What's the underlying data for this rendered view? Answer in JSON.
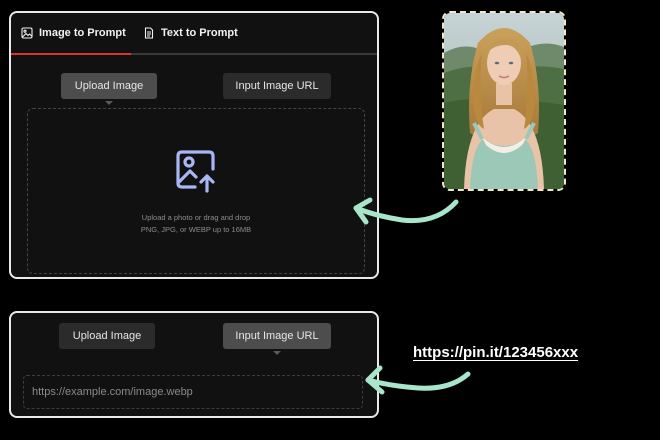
{
  "tabs": [
    {
      "label": "Image to Prompt",
      "icon": "image-icon",
      "active": true
    },
    {
      "label": "Text to Prompt",
      "icon": "document-icon",
      "active": false
    }
  ],
  "top_panel": {
    "upload_button": "Upload Image",
    "url_button": "Input Image URL",
    "dropzone": {
      "icon": "image-upload-icon",
      "line1": "Upload a photo or drag and drop",
      "line2": "PNG, JPG, or WEBP up to 16MB"
    }
  },
  "bottom_panel": {
    "upload_button": "Upload Image",
    "url_button": "Input Image URL",
    "url_placeholder": "https://example.com/image.webp"
  },
  "annotation": {
    "url_example": "https://pin.it/123456xxx"
  },
  "colors": {
    "accent": "#e0312f",
    "arrow": "#a8e6cc",
    "panel_border": "#e9e9e9",
    "upload_icon": "#a9b6f5"
  }
}
